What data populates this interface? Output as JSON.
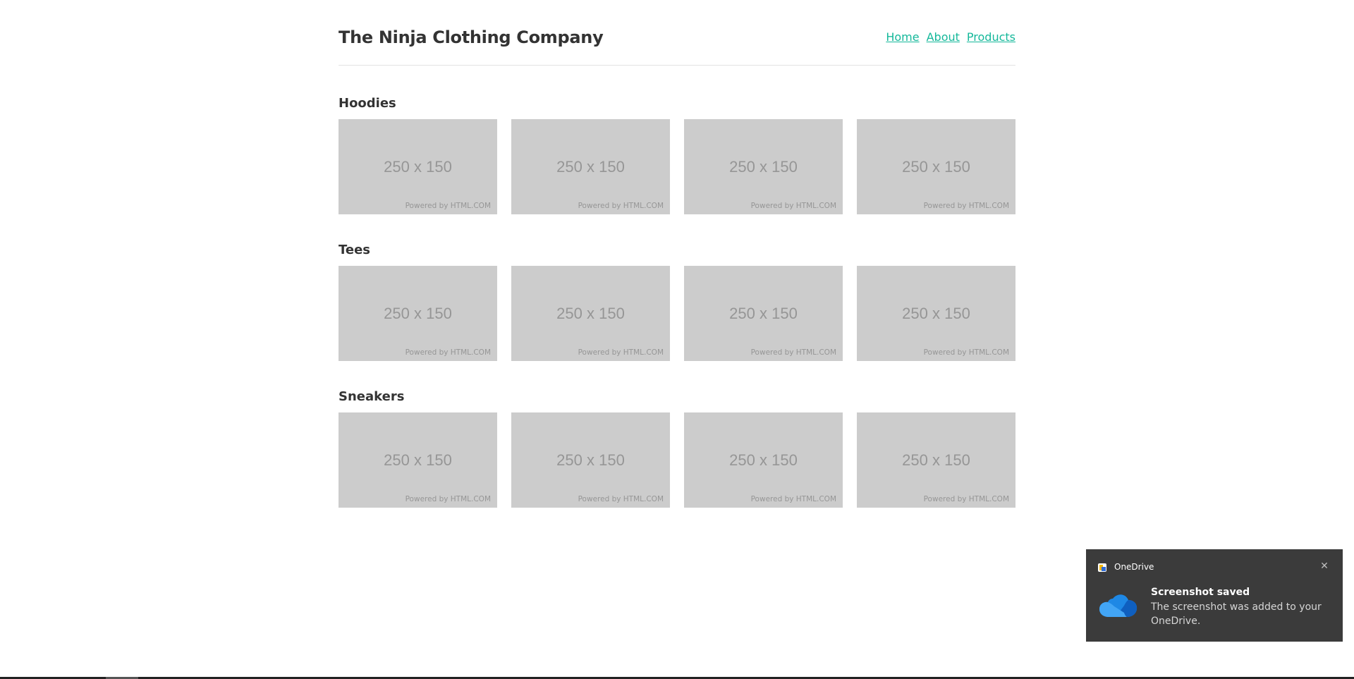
{
  "header": {
    "site_title": "The Ninja Clothing Company",
    "nav": [
      "Home",
      "About",
      "Products"
    ]
  },
  "sections": [
    {
      "title": "Hoodies",
      "items": [
        {
          "size_text": "250 x 150",
          "powered_text": "Powered by HTML.COM"
        },
        {
          "size_text": "250 x 150",
          "powered_text": "Powered by HTML.COM"
        },
        {
          "size_text": "250 x 150",
          "powered_text": "Powered by HTML.COM"
        },
        {
          "size_text": "250 x 150",
          "powered_text": "Powered by HTML.COM"
        }
      ]
    },
    {
      "title": "Tees",
      "items": [
        {
          "size_text": "250 x 150",
          "powered_text": "Powered by HTML.COM"
        },
        {
          "size_text": "250 x 150",
          "powered_text": "Powered by HTML.COM"
        },
        {
          "size_text": "250 x 150",
          "powered_text": "Powered by HTML.COM"
        },
        {
          "size_text": "250 x 150",
          "powered_text": "Powered by HTML.COM"
        }
      ]
    },
    {
      "title": "Sneakers",
      "items": [
        {
          "size_text": "250 x 150",
          "powered_text": "Powered by HTML.COM"
        },
        {
          "size_text": "250 x 150",
          "powered_text": "Powered by HTML.COM"
        },
        {
          "size_text": "250 x 150",
          "powered_text": "Powered by HTML.COM"
        },
        {
          "size_text": "250 x 150",
          "powered_text": "Powered by HTML.COM"
        }
      ]
    }
  ],
  "toast": {
    "app_name": "OneDrive",
    "app_icon": "onedrive-app-icon",
    "title": "Screenshot saved",
    "body": "The screenshot was added to your OneDrive.",
    "close_icon": "close-icon",
    "cloud_icon": "onedrive-cloud-icon"
  },
  "colors": {
    "link": "#14b89a",
    "heading": "#333333",
    "placeholder_bg": "#cccccc",
    "placeholder_text": "#969696",
    "toast_bg": "#3b3b3b"
  }
}
